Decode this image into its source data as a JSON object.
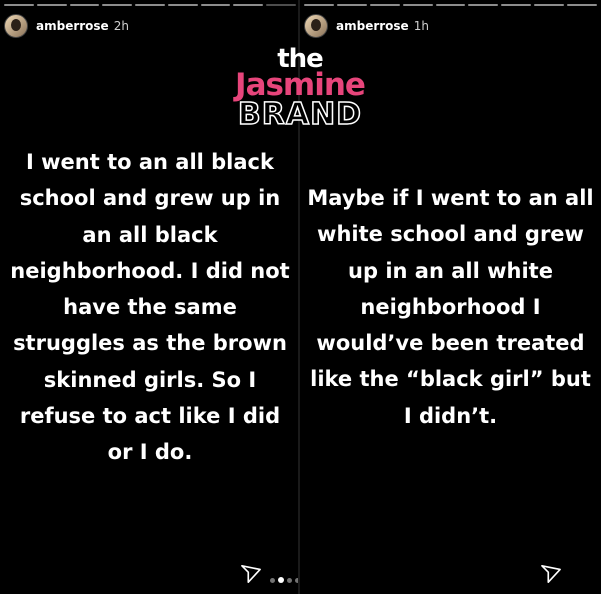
{
  "left_story": {
    "username": "amberrose",
    "time": "2h",
    "caption_lines": [
      "I went to an all black",
      "school and grew up in",
      "an all black",
      "neighborhood. I did not",
      "have the same",
      "struggles as the brown",
      "skinned girls. So I",
      "refuse to act like I did",
      "or I do."
    ]
  },
  "right_story": {
    "username": "amberrose",
    "time": "1h",
    "caption_lines": [
      "Maybe if I went to an all",
      "white school and grew",
      "up in an all white",
      "neighborhood I",
      "would’ve been treated",
      "like the “black girl” but",
      "I didn’t."
    ]
  },
  "watermark": {
    "the": "the",
    "name": "Jasmine",
    "brand": "BRAND"
  },
  "icons": {
    "send": "send-icon",
    "avatar": "avatar"
  },
  "colors": {
    "background": "#000000",
    "text": "#ffffff",
    "brand_pink": "#e7457b"
  },
  "pagination": {
    "total": 6,
    "active_index": 1
  }
}
